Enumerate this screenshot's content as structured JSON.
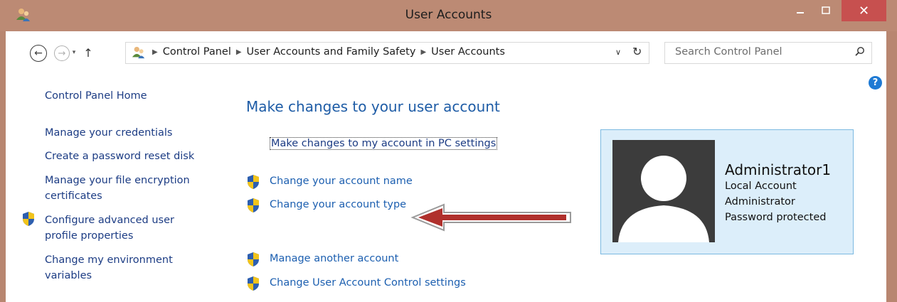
{
  "window": {
    "title": "User Accounts",
    "minimize": "–",
    "maximize": "□",
    "close": "✕"
  },
  "nav": {
    "back": "←",
    "forward": "→",
    "dropdown": "▾",
    "up": "↑",
    "breadcrumb": [
      "Control Panel",
      "User Accounts and Family Safety",
      "User Accounts"
    ],
    "address_dropdown": "∨",
    "refresh": "↻",
    "search_placeholder": "Search Control Panel",
    "help": "?"
  },
  "sidebar": {
    "home": "Control Panel Home",
    "items": [
      {
        "label": "Manage your credentials"
      },
      {
        "label": "Create a password reset disk"
      },
      {
        "label": "Manage your file encryption certificates"
      },
      {
        "label": "Configure advanced user profile properties",
        "icon": "uac-shield-icon"
      },
      {
        "label": "Change my environment variables"
      }
    ]
  },
  "main": {
    "heading": "Make changes to your user account",
    "pc_settings_link": "Make changes to my account in PC settings",
    "links": [
      {
        "label": "Change your account name",
        "icon": "uac-shield-icon"
      },
      {
        "label": "Change your account type",
        "icon": "uac-shield-icon"
      },
      {
        "label": "Manage another account",
        "icon": "uac-shield-icon"
      },
      {
        "label": "Change User Account Control settings",
        "icon": "uac-shield-icon"
      }
    ]
  },
  "account": {
    "name": "Administrator1",
    "type": "Local Account",
    "role": "Administrator",
    "status": "Password protected"
  },
  "colors": {
    "titlebar": "#bc8a74",
    "close": "#c7504f",
    "link": "#1c5fb0",
    "heading": "#1e5ca6",
    "card_bg": "#dceefa",
    "card_border": "#7bb9e1",
    "arrow": "#b0302c"
  }
}
